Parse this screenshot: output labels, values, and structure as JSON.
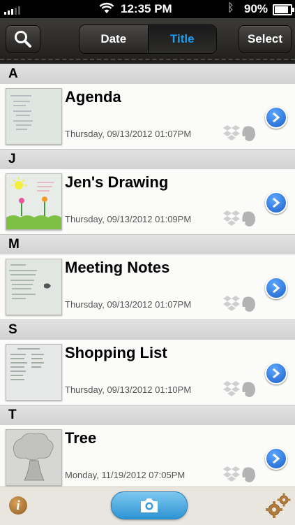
{
  "status_bar": {
    "time": "12:35 PM",
    "battery": "90%"
  },
  "toolbar": {
    "search_icon": "search-icon",
    "sort_options": [
      "Date",
      "Title"
    ],
    "selected_sort": "Title",
    "select_label": "Select"
  },
  "sections": [
    {
      "letter": "A",
      "note": {
        "title": "Agenda",
        "date": "Thursday, 09/13/2012 01:07PM"
      }
    },
    {
      "letter": "J",
      "note": {
        "title": "Jen's Drawing",
        "date": "Thursday, 09/13/2012 01:09PM"
      }
    },
    {
      "letter": "M",
      "note": {
        "title": "Meeting Notes",
        "date": "Thursday, 09/13/2012 01:07PM"
      }
    },
    {
      "letter": "S",
      "note": {
        "title": "Shopping List",
        "date": "Thursday, 09/13/2012 01:10PM"
      }
    },
    {
      "letter": "T",
      "note": {
        "title": "Tree",
        "date": "Monday, 11/19/2012 07:05PM"
      }
    }
  ],
  "row_icons": {
    "sync_1": "dropbox-icon",
    "sync_2": "evernote-icon",
    "action": "disclosure-arrow-icon"
  },
  "bottom_bar": {
    "left_icon": "info-icon",
    "center_icon": "camera-icon",
    "right_icon": "gear-icon"
  },
  "colors": {
    "accent_blue": "#1e9cf0",
    "disclosure_blue": "#1c5fc9",
    "camera_button": "#2f94d3"
  }
}
